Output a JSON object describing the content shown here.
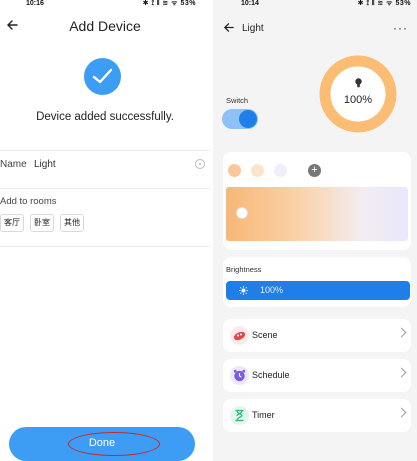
{
  "left": {
    "status": {
      "time": "10:16",
      "icons_text": "✱ ⟟ 𝍪 ≋ ᯤ 53%"
    },
    "header": {
      "title": "Add Device"
    },
    "success": {
      "message": "Device added successfully."
    },
    "name_field": {
      "label": "Name",
      "value": "Light"
    },
    "rooms": {
      "label": "Add to rooms",
      "chips": [
        "客厅",
        "卧室",
        "其他"
      ]
    },
    "done_button": {
      "label": "Done"
    }
  },
  "right": {
    "status": {
      "time": "10:14",
      "icons_text": "✱ ⟟ 𝍪 ≋ ᯤ 53%"
    },
    "header": {
      "title": "Light"
    },
    "switch": {
      "label": "Switch",
      "on": true
    },
    "ring": {
      "value": "100%",
      "level": 1.0
    },
    "colors": {
      "swatches": [
        "#f8c89b",
        "#fbe4c9",
        "#f0eff8"
      ],
      "gradient": [
        "#f7b777",
        "#fad2a8",
        "#f3ecf2",
        "#e9e7fb"
      ]
    },
    "brightness": {
      "label": "Brightness",
      "value": "100%"
    },
    "rows": [
      {
        "label": "Scene",
        "icon": "scene-icon",
        "color": "#fdeaea"
      },
      {
        "label": "Schedule",
        "icon": "schedule-icon",
        "color": "#ece8fb"
      },
      {
        "label": "Timer",
        "icon": "timer-icon",
        "color": "#e3f5ec"
      }
    ]
  },
  "colors": {
    "accent": "#3d9df5",
    "primary_blue": "#1f7ee8",
    "ring_orange": "#fbbd74",
    "annotation_red": "#c62828"
  }
}
